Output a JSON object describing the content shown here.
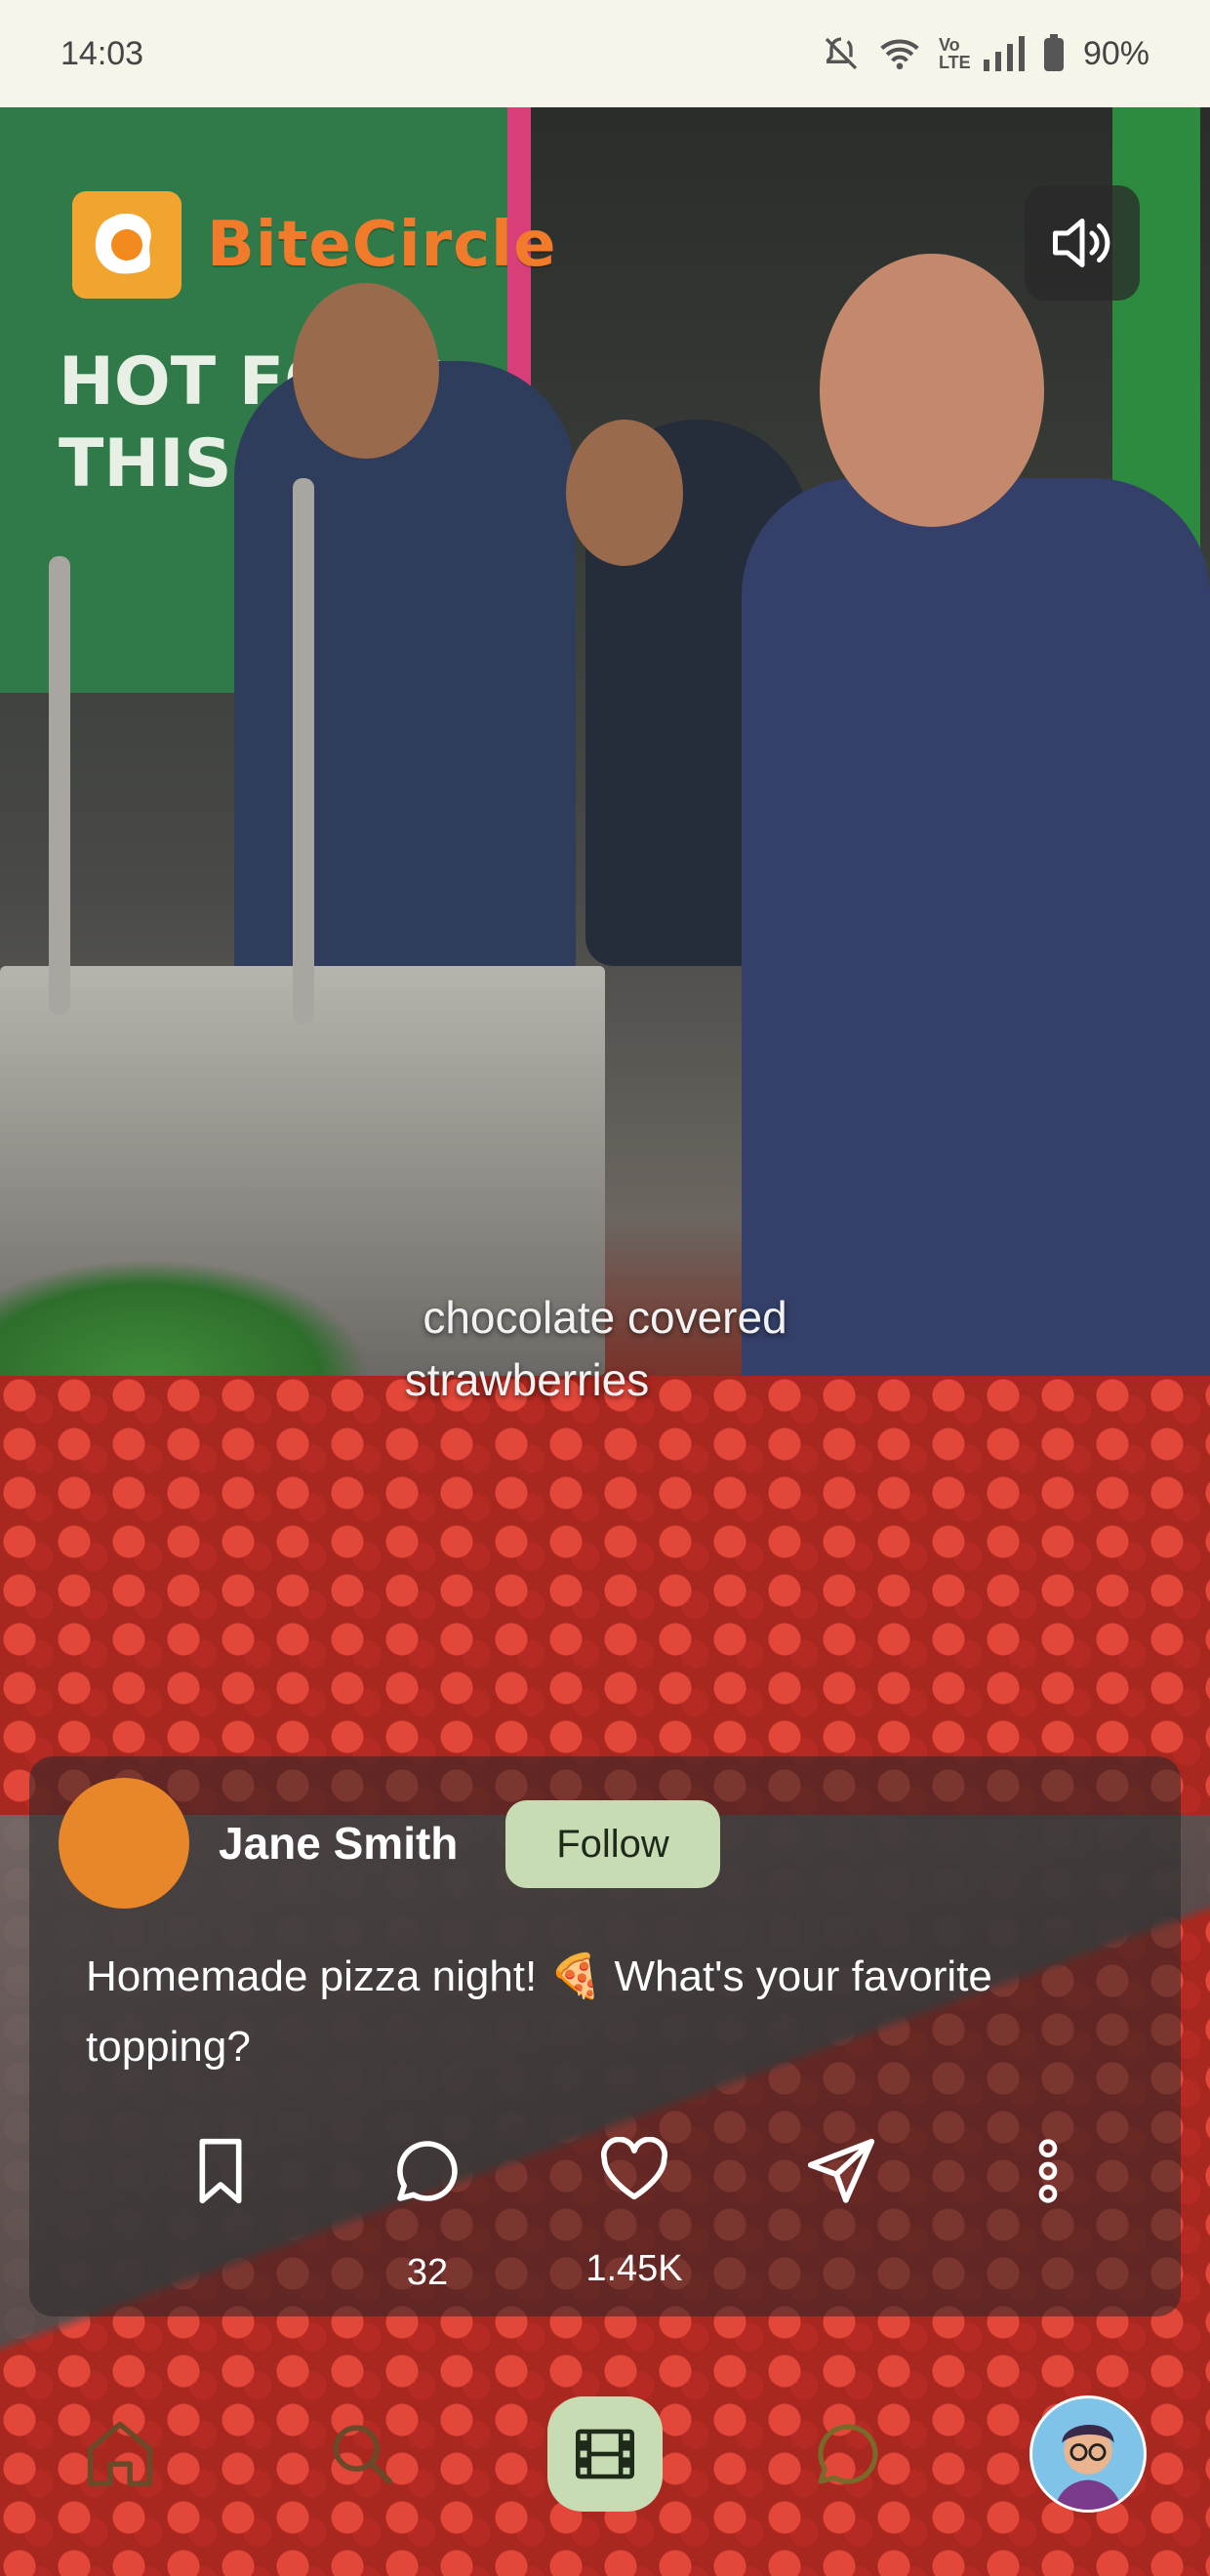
{
  "status_bar": {
    "time": "14:03",
    "battery": "90%",
    "icons": [
      "mute-icon",
      "wifi-icon",
      "volte-icon",
      "signal-icon",
      "battery-icon"
    ]
  },
  "brand": {
    "name": "BiteCircle",
    "logo_icon": "fried-egg-icon"
  },
  "video": {
    "caption_line1": "chocolate covered",
    "caption_line2": "strawberries",
    "volume_icon": "speaker-icon"
  },
  "post": {
    "author": "Jane Smith",
    "follow_label": "Follow",
    "text": "Homemade pizza night! 🍕 What's your favorite topping?",
    "actions": [
      {
        "name": "bookmark",
        "icon": "bookmark-icon",
        "count": ""
      },
      {
        "name": "comment",
        "icon": "comment-icon",
        "count": "32"
      },
      {
        "name": "like",
        "icon": "heart-icon",
        "count": "1.45K"
      },
      {
        "name": "share",
        "icon": "send-icon",
        "count": ""
      },
      {
        "name": "more",
        "icon": "more-vertical-icon",
        "count": ""
      }
    ]
  },
  "nav": {
    "items": [
      "home-icon",
      "search-icon",
      "reels-icon",
      "chat-icon",
      "profile-avatar"
    ],
    "active": "reels-icon"
  },
  "colors": {
    "accent": "#c8dcb4",
    "brand": "#f27a2b",
    "avatar": "#e8862a"
  }
}
